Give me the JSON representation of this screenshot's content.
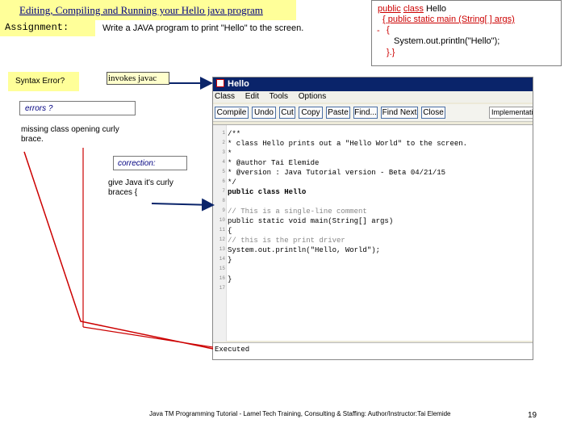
{
  "slide": {
    "title": "Editing, Compiling and Running your Hello java program",
    "assignment_label": "Assignment:",
    "assignment_task": "Write a JAVA program to print \"Hello\" to the screen."
  },
  "code_snippet": {
    "line1_kw1": "public",
    "line1_kw2": "class",
    "line1_rest": "Hello",
    "line2": "{ public static main (String[ ] args)",
    "line3_dash": "-",
    "line3": "{",
    "line4": "System.out.println(\"Hello\");",
    "line5": "}.}"
  },
  "callouts": {
    "syntax_error": "Syntax Error?",
    "invokes": "invokes javac",
    "errors": "errors ?",
    "missing": "missing class opening curly brace.",
    "correction": "correction:",
    "give": "give Java it's curly braces {"
  },
  "ide": {
    "window_title": "Hello",
    "menu": [
      "Class",
      "Edit",
      "Tools",
      "Options"
    ],
    "toolbar": [
      "Compile",
      "Undo",
      "Cut",
      "Copy",
      "Paste",
      "Find...",
      "Find Next",
      "Close"
    ],
    "toolbar_right": "Implementati",
    "line_numbers": [
      "1",
      "2",
      "3",
      "4",
      "5",
      "6",
      "7",
      "8",
      "9",
      "10",
      "11",
      "12",
      "13",
      "14",
      "15",
      "16",
      "17"
    ],
    "code_lines": [
      "/**",
      " * class Hello prints out a \"Hello World\" to the screen.",
      " *",
      " * @author Tai Elemide",
      " * @version : Java Tutorial version - Beta 04/21/15",
      " */",
      "public class Hello",
      "",
      "    // This is a single-line comment",
      "    public static void main(String[] args)",
      "    {",
      "        // this is the print driver",
      "        System.out.println(\"Hello, World\");",
      "    }",
      "",
      "}"
    ],
    "status": "Executed"
  },
  "footer": {
    "text": "Java TM Programming Tutorial - Lamel Tech Training, Consulting & Staffing: Author/Instructor:Tai Elemide",
    "page": "19"
  },
  "colors": {
    "banner": "#ffff99",
    "keyword": "#cc0000",
    "ide_title": "#0a246a",
    "arrow": "#0a246a",
    "callout_line": "#cc0000"
  }
}
